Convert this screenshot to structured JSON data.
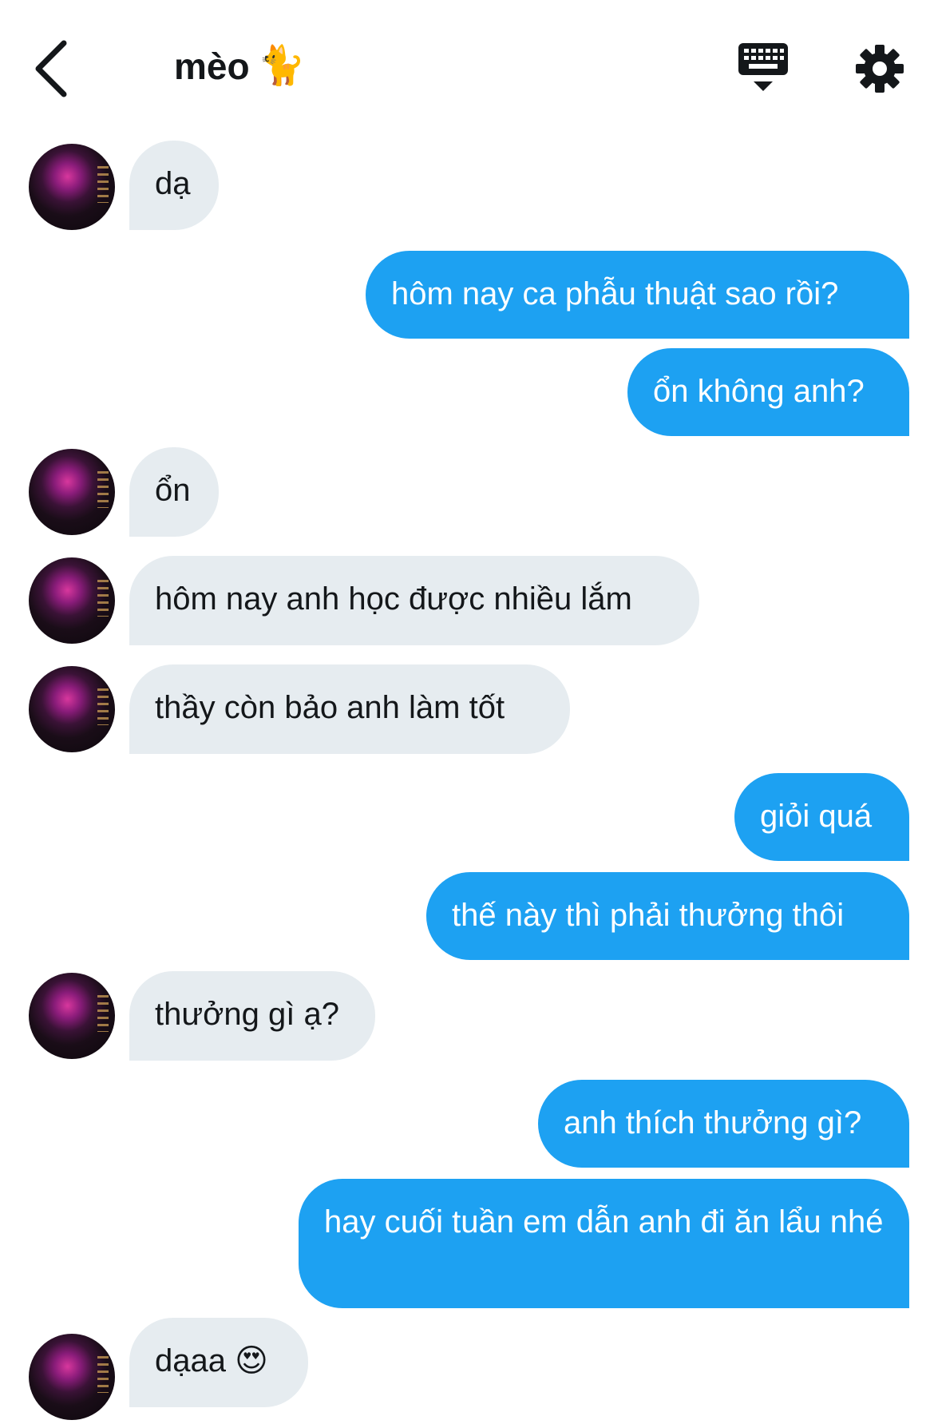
{
  "header": {
    "back_icon": "chevron-left-icon",
    "title": "mèo",
    "title_emoji": "🐈",
    "keyboard_icon": "keyboard-icon",
    "settings_icon": "gear-icon"
  },
  "colors": {
    "incoming_bubble": "#e6ecf0",
    "outgoing_bubble": "#1da1f2",
    "incoming_text": "#14171a",
    "outgoing_text": "#ffffff"
  },
  "messages": [
    {
      "from": "them",
      "text": "dạ"
    },
    {
      "from": "me",
      "text": "hôm nay ca phẫu thuật sao rồi?"
    },
    {
      "from": "me",
      "text": "ổn không anh?"
    },
    {
      "from": "them",
      "text": "ổn"
    },
    {
      "from": "them",
      "text": "hôm nay anh học được nhiều lắm"
    },
    {
      "from": "them",
      "text": "thầy còn bảo anh làm tốt"
    },
    {
      "from": "me",
      "text": "giỏi quá"
    },
    {
      "from": "me",
      "text": "thế này thì phải thưởng thôi"
    },
    {
      "from": "them",
      "text": "thưởng gì ạ?"
    },
    {
      "from": "me",
      "text": "anh thích thưởng gì?"
    },
    {
      "from": "me",
      "text": "hay cuối tuần em dẫn anh đi ăn lẩu nhé"
    },
    {
      "from": "them",
      "text": "dạaa",
      "emoji": "😍"
    }
  ]
}
